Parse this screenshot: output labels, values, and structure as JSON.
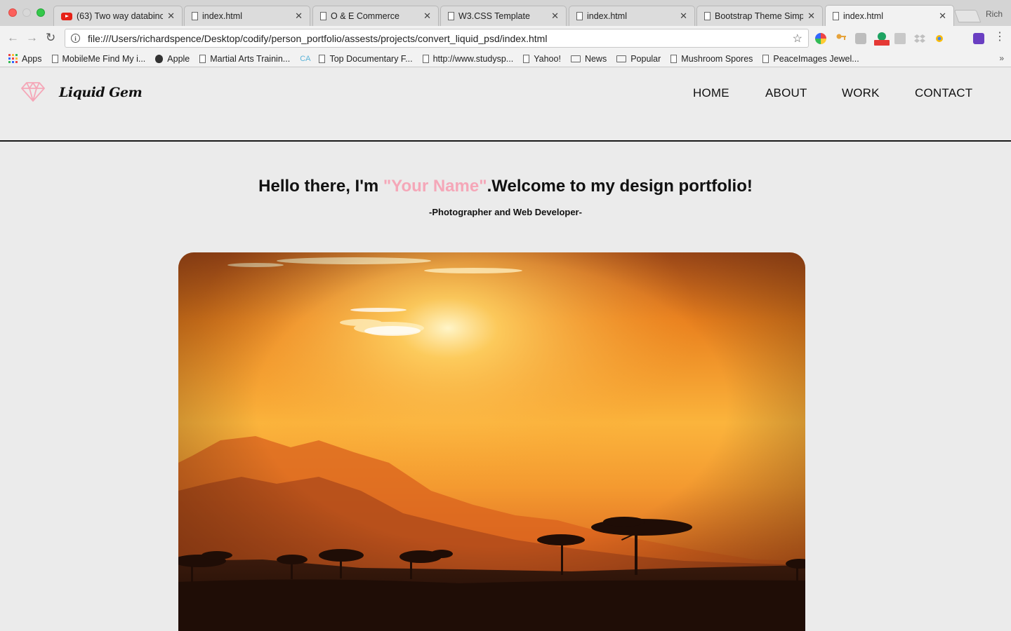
{
  "browser": {
    "tabs": [
      {
        "title": "(63) Two way databinc",
        "icon": "youtube-icon",
        "active": false
      },
      {
        "title": "index.html",
        "icon": "document-icon",
        "active": false
      },
      {
        "title": "O & E Commerce",
        "icon": "document-icon",
        "active": false
      },
      {
        "title": "W3.CSS Template",
        "icon": "document-icon",
        "active": false
      },
      {
        "title": "index.html",
        "icon": "document-icon",
        "active": false
      },
      {
        "title": "Bootstrap Theme Simp",
        "icon": "document-icon",
        "active": false
      },
      {
        "title": "index.html",
        "icon": "document-icon",
        "active": true
      }
    ],
    "close_glyph": "✕",
    "profile_name": "Rich",
    "url": "file:///Users/richardspence/Desktop/codify/person_portfolio/assests/projects/convert_liquid_psd/index.html",
    "bookmarks": [
      {
        "label": "Apps",
        "icon": "apps-grid-icon"
      },
      {
        "label": "MobileMe Find My i...",
        "icon": "document-icon"
      },
      {
        "label": "Apple",
        "icon": "apple-icon"
      },
      {
        "label": "Martial Arts Trainin...",
        "icon": "document-icon"
      },
      {
        "label": "Top Documentary F...",
        "icon": "document-icon"
      },
      {
        "label": "http://www.studysp...",
        "icon": "document-icon"
      },
      {
        "label": "Yahoo!",
        "icon": "document-icon"
      },
      {
        "label": "News",
        "icon": "folder-icon"
      },
      {
        "label": "Popular",
        "icon": "folder-icon"
      },
      {
        "label": "Mushroom Spores",
        "icon": "document-icon"
      },
      {
        "label": "PeaceImages Jewel...",
        "icon": "document-icon"
      }
    ],
    "ca_badge": "CA",
    "overflow_glyph": "»"
  },
  "site": {
    "brand": "Liquid Gem",
    "brand_color": "#f5a7b8",
    "nav": [
      "HOME",
      "ABOUT",
      "WORK",
      "CONTACT"
    ],
    "hero": {
      "greeting": "Hello there, I'm ",
      "name": "\"Your Name\"",
      "welcome": ".Welcome to my design portfolio!",
      "subtitle": "-Photographer and Web Developer-"
    },
    "hero_image": "african-savanna-sunset-photo"
  }
}
